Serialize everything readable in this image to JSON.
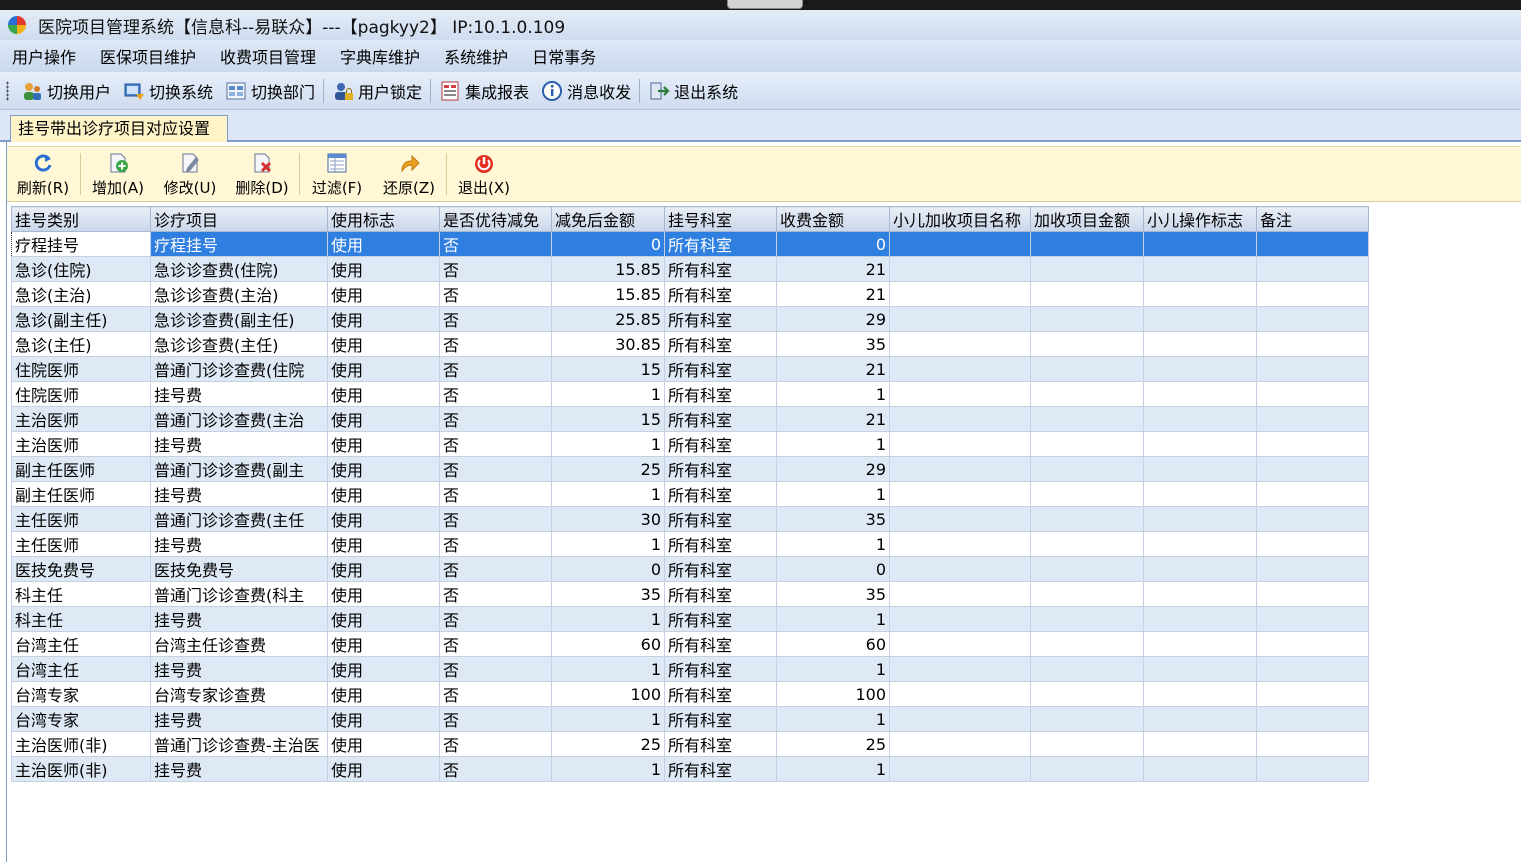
{
  "window": {
    "title": "医院项目管理系统【信息科--易联众】---【pagkyy2】 IP:10.1.0.109"
  },
  "menubar": [
    "用户操作",
    "医保项目维护",
    "收费项目管理",
    "字典库维护",
    "系统维护",
    "日常事务"
  ],
  "toolbar": [
    {
      "label": "切换用户",
      "icon": "switch-user-icon"
    },
    {
      "label": "切换系统",
      "icon": "switch-system-icon"
    },
    {
      "label": "切换部门",
      "icon": "switch-department-icon"
    },
    {
      "label": "用户锁定",
      "icon": "user-lock-icon"
    },
    {
      "label": "集成报表",
      "icon": "report-icon"
    },
    {
      "label": "消息收发",
      "icon": "info-icon"
    },
    {
      "label": "退出系统",
      "icon": "exit-system-icon"
    }
  ],
  "tab": {
    "label": "挂号带出诊疗项目对应设置"
  },
  "actions": [
    {
      "label": "刷新(R)",
      "icon": "refresh-icon"
    },
    {
      "label": "增加(A)",
      "icon": "add-icon"
    },
    {
      "label": "修改(U)",
      "icon": "edit-icon"
    },
    {
      "label": "删除(D)",
      "icon": "delete-icon"
    },
    {
      "label": "过滤(F)",
      "icon": "filter-icon"
    },
    {
      "label": "还原(Z)",
      "icon": "restore-icon"
    },
    {
      "label": "退出(X)",
      "icon": "power-icon"
    }
  ],
  "grid": {
    "columns": [
      "挂号类别",
      "诊疗项目",
      "使用标志",
      "是否优待减免",
      "减免后金额",
      "挂号科室",
      "收费金额",
      "小儿加收项目名称",
      "加收项目金额",
      "小儿操作标志",
      "备注"
    ],
    "selected_row": 0,
    "rows": [
      [
        "疗程挂号",
        "疗程挂号",
        "使用",
        "否",
        "0",
        "所有科室",
        "0",
        "",
        "",
        "",
        ""
      ],
      [
        "急诊(住院)",
        "急诊诊查费(住院)",
        "使用",
        "否",
        "15.85",
        "所有科室",
        "21",
        "",
        "",
        "",
        ""
      ],
      [
        "急诊(主治)",
        "急诊诊查费(主治)",
        "使用",
        "否",
        "15.85",
        "所有科室",
        "21",
        "",
        "",
        "",
        ""
      ],
      [
        "急诊(副主任)",
        "急诊诊查费(副主任)",
        "使用",
        "否",
        "25.85",
        "所有科室",
        "29",
        "",
        "",
        "",
        ""
      ],
      [
        "急诊(主任)",
        "急诊诊查费(主任)",
        "使用",
        "否",
        "30.85",
        "所有科室",
        "35",
        "",
        "",
        "",
        ""
      ],
      [
        "住院医师",
        "普通门诊诊查费(住院",
        "使用",
        "否",
        "15",
        "所有科室",
        "21",
        "",
        "",
        "",
        ""
      ],
      [
        "住院医师",
        "挂号费",
        "使用",
        "否",
        "1",
        "所有科室",
        "1",
        "",
        "",
        "",
        ""
      ],
      [
        "主治医师",
        "普通门诊诊查费(主治",
        "使用",
        "否",
        "15",
        "所有科室",
        "21",
        "",
        "",
        "",
        ""
      ],
      [
        "主治医师",
        "挂号费",
        "使用",
        "否",
        "1",
        "所有科室",
        "1",
        "",
        "",
        "",
        ""
      ],
      [
        "副主任医师",
        "普通门诊诊查费(副主",
        "使用",
        "否",
        "25",
        "所有科室",
        "29",
        "",
        "",
        "",
        ""
      ],
      [
        "副主任医师",
        "挂号费",
        "使用",
        "否",
        "1",
        "所有科室",
        "1",
        "",
        "",
        "",
        ""
      ],
      [
        "主任医师",
        "普通门诊诊查费(主任",
        "使用",
        "否",
        "30",
        "所有科室",
        "35",
        "",
        "",
        "",
        ""
      ],
      [
        "主任医师",
        "挂号费",
        "使用",
        "否",
        "1",
        "所有科室",
        "1",
        "",
        "",
        "",
        ""
      ],
      [
        "医技免费号",
        "医技免费号",
        "使用",
        "否",
        "0",
        "所有科室",
        "0",
        "",
        "",
        "",
        ""
      ],
      [
        "科主任",
        "普通门诊诊查费(科主",
        "使用",
        "否",
        "35",
        "所有科室",
        "35",
        "",
        "",
        "",
        ""
      ],
      [
        "科主任",
        "挂号费",
        "使用",
        "否",
        "1",
        "所有科室",
        "1",
        "",
        "",
        "",
        ""
      ],
      [
        "台湾主任",
        "台湾主任诊查费",
        "使用",
        "否",
        "60",
        "所有科室",
        "60",
        "",
        "",
        "",
        ""
      ],
      [
        "台湾主任",
        "挂号费",
        "使用",
        "否",
        "1",
        "所有科室",
        "1",
        "",
        "",
        "",
        ""
      ],
      [
        "台湾专家",
        "台湾专家诊查费",
        "使用",
        "否",
        "100",
        "所有科室",
        "100",
        "",
        "",
        "",
        ""
      ],
      [
        "台湾专家",
        "挂号费",
        "使用",
        "否",
        "1",
        "所有科室",
        "1",
        "",
        "",
        "",
        ""
      ],
      [
        "主治医师(非)",
        "普通门诊诊查费-主治医",
        "使用",
        "否",
        "25",
        "所有科室",
        "25",
        "",
        "",
        "",
        ""
      ],
      [
        "主治医师(非)",
        "挂号费",
        "使用",
        "否",
        "1",
        "所有科室",
        "1",
        "",
        "",
        "",
        ""
      ]
    ]
  },
  "colors": {
    "selection": "#2f7fe0",
    "row_alt": "#dfe9f6",
    "action_bar": "#fff7d6",
    "tab": "#fff4c8"
  }
}
